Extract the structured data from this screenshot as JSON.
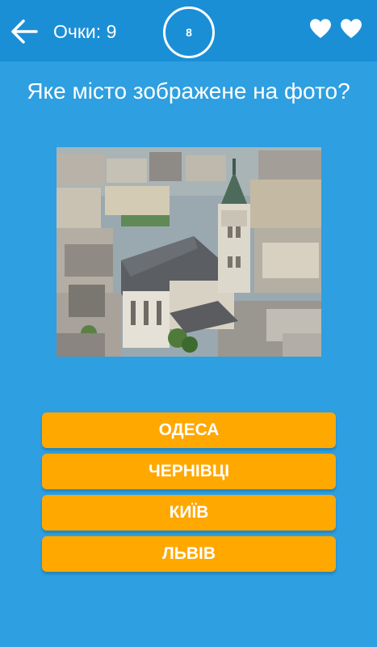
{
  "header": {
    "back_icon": "arrow-left-icon",
    "score_label": "Очки: 9",
    "timer_value": "8",
    "lives_icon": "heart-icon",
    "lives_count": 2
  },
  "question": {
    "text": "Яке місто зображене на фото?"
  },
  "answers": [
    {
      "label": "ОДЕСА"
    },
    {
      "label": "ЧЕРНІВЦІ"
    },
    {
      "label": "КИЇВ"
    },
    {
      "label": "ЛЬВІВ"
    }
  ],
  "colors": {
    "background": "#2e9fe0",
    "header": "#1a8fd6",
    "answer_button": "#ffa800",
    "text": "#ffffff"
  }
}
